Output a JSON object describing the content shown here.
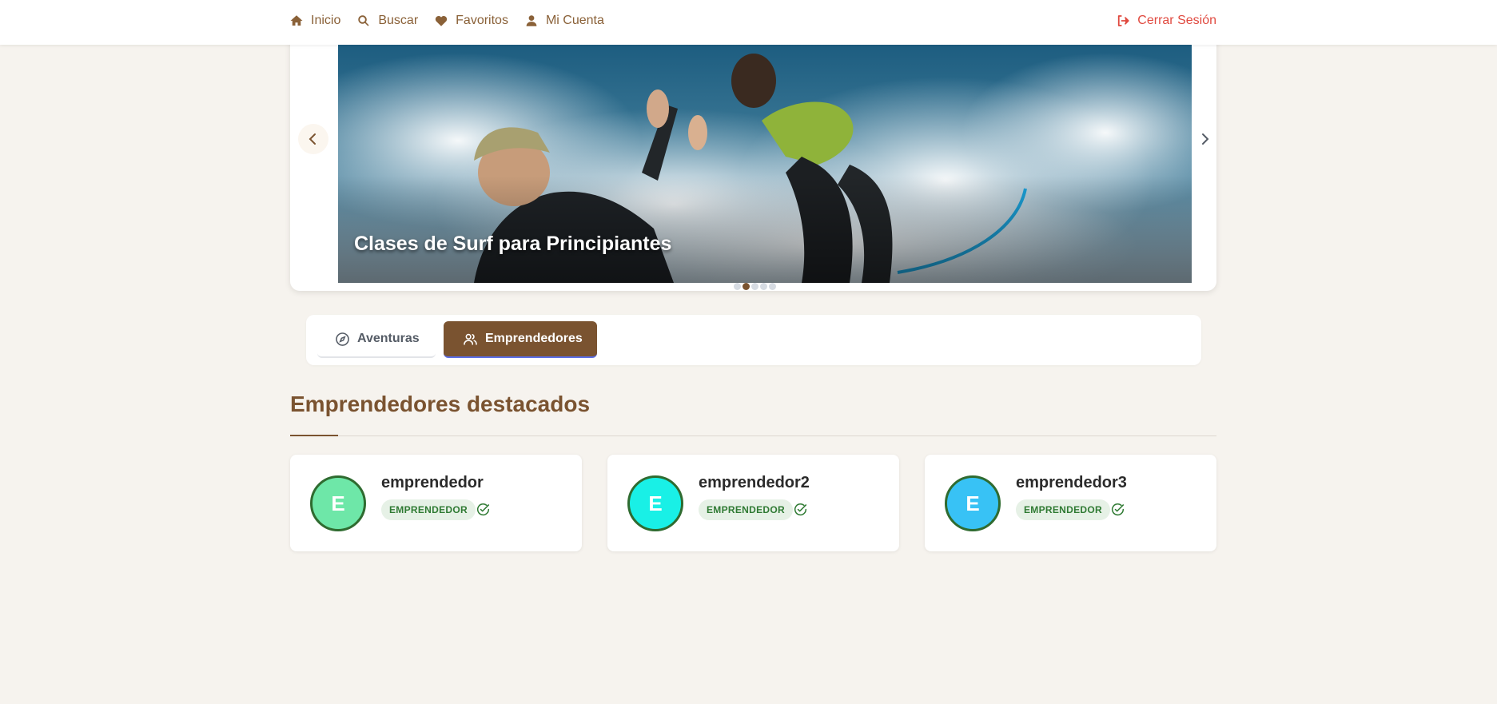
{
  "nav": {
    "home": "Inicio",
    "search": "Buscar",
    "favorites": "Favoritos",
    "account": "Mi Cuenta",
    "logout": "Cerrar Sesión",
    "brand_color": "#8a6138",
    "logout_color": "#e0493f"
  },
  "carousel": {
    "caption": "Clases de Surf para Principiantes",
    "slide_count": 5,
    "active_index": 1
  },
  "tabs": {
    "adventures": "Aventuras",
    "entrepreneurs": "Emprendedores",
    "active": "entrepreneurs"
  },
  "section": {
    "title": "Emprendedores destacados"
  },
  "entrepreneurs": [
    {
      "initial": "E",
      "name": "emprendedor",
      "role": "EMPRENDEDOR",
      "avatar_color": "#6ee7a8"
    },
    {
      "initial": "E",
      "name": "emprendedor2",
      "role": "EMPRENDEDOR",
      "avatar_color": "#19f0e6"
    },
    {
      "initial": "E",
      "name": "emprendedor3",
      "role": "EMPRENDEDOR",
      "avatar_color": "#38c2f5"
    }
  ],
  "colors": {
    "accent": "#7a5330",
    "background": "#f6f3ee",
    "badge_text": "#2f7a33",
    "badge_bg": "#e6f1e6"
  }
}
